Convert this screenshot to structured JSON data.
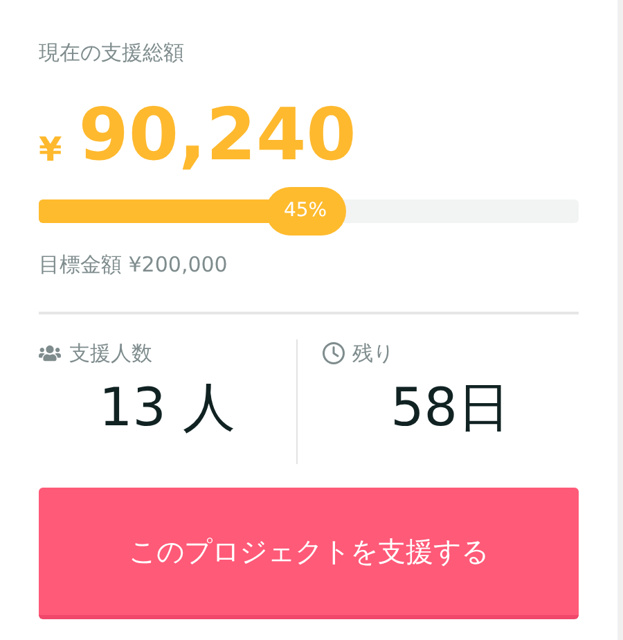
{
  "title": "現在の支援総額",
  "amount": {
    "currency": "¥",
    "value": "90,240"
  },
  "progress": {
    "level": 0.45,
    "label": "45%"
  },
  "goal": "目標金額 ¥200,000",
  "stats": [
    {
      "kind": "people",
      "label": "支援人数",
      "value": "13 人"
    },
    {
      "kind": "time",
      "label": "残り",
      "value": "58日"
    }
  ],
  "button": "このプロジェクトを支援する"
}
